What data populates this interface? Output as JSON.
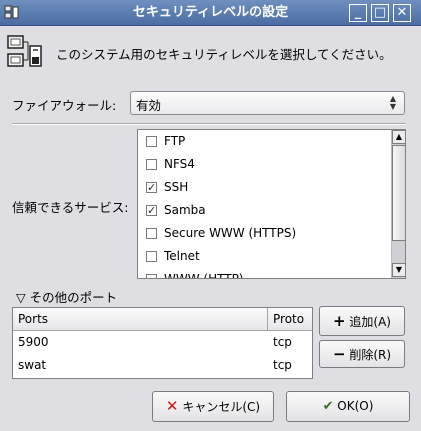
{
  "window": {
    "title": "セキュリティレベルの設定",
    "minimize_glyph": "_",
    "maximize_glyph": "□",
    "close_glyph": "✕"
  },
  "header": {
    "icon": "security-level-icon",
    "text": "このシステム用のセキュリティレベルを選択してください。"
  },
  "firewall": {
    "label": "ファイアウォール:",
    "value": "有効"
  },
  "services": {
    "label": "信頼できるサービス:",
    "items": [
      {
        "label": "FTP",
        "checked": false
      },
      {
        "label": "NFS4",
        "checked": false
      },
      {
        "label": "SSH",
        "checked": true
      },
      {
        "label": "Samba",
        "checked": true
      },
      {
        "label": "Secure WWW (HTTPS)",
        "checked": false
      },
      {
        "label": "Telnet",
        "checked": false
      },
      {
        "label": "WWW (HTTP)",
        "checked": false
      }
    ]
  },
  "other_ports": {
    "expander_label": "その他のポート",
    "columns": [
      "Ports",
      "Proto"
    ],
    "rows": [
      {
        "port": "5900",
        "proto": "tcp"
      },
      {
        "port": "swat",
        "proto": "tcp"
      }
    ],
    "add_label": "追加(A)",
    "remove_label": "削除(R)"
  },
  "actions": {
    "cancel_label": "キャンセル(C)",
    "ok_label": "OK(O)"
  },
  "colors": {
    "titlebar": "#5a7db3",
    "dialog_bg": "#dfdfe3",
    "cancel_icon": "#cc1b1b"
  }
}
